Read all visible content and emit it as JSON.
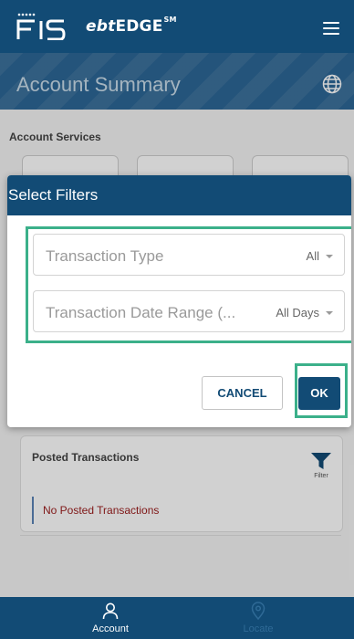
{
  "header": {
    "brand_logo": "FIS",
    "brand_prefix": "ebt",
    "brand_suffix": "EDGE",
    "brand_mark": "SM",
    "menu_icon": "hamburger-menu-icon"
  },
  "banner": {
    "title": "Account Summary",
    "language_icon": "globe-icon"
  },
  "services": {
    "label": "Account Services"
  },
  "filter_dialog": {
    "title": "Select Filters",
    "transaction_type": {
      "label": "Transaction Type",
      "value": "All"
    },
    "date_range": {
      "label": "Transaction Date Range (...",
      "value": "All Days"
    },
    "cancel_label": "CANCEL",
    "ok_label": "OK"
  },
  "posted": {
    "title": "Posted Transactions",
    "filter_label": "Filter",
    "filter_icon": "funnel-icon",
    "empty_text": "No Posted Transactions"
  },
  "bottom_nav": {
    "account_label": "Account",
    "locate_label": "Locate"
  },
  "colors": {
    "primary": "#124b75",
    "banner": "#2d6796",
    "highlight": "#3bb08a",
    "error_text": "#9b1c1c"
  }
}
